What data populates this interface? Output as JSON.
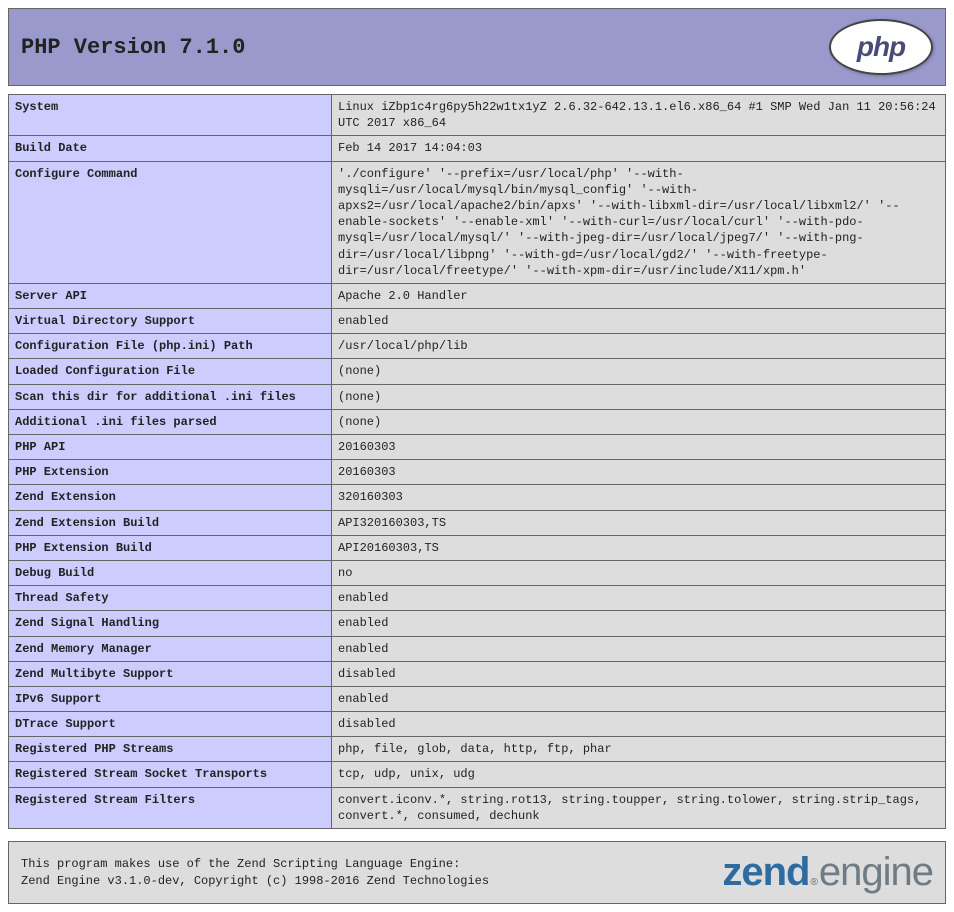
{
  "header": {
    "title": "PHP Version 7.1.0",
    "logo_text": "php"
  },
  "rows": [
    {
      "label": "System",
      "value": "Linux iZbp1c4rg6py5h22w1tx1yZ 2.6.32-642.13.1.el6.x86_64 #1 SMP Wed Jan 11 20:56:24 UTC 2017 x86_64"
    },
    {
      "label": "Build Date",
      "value": "Feb 14 2017 14:04:03"
    },
    {
      "label": "Configure Command",
      "value": "'./configure' '--prefix=/usr/local/php' '--with-mysqli=/usr/local/mysql/bin/mysql_config' '--with-apxs2=/usr/local/apache2/bin/apxs' '--with-libxml-dir=/usr/local/libxml2/' '--enable-sockets' '--enable-xml' '--with-curl=/usr/local/curl' '--with-pdo-mysql=/usr/local/mysql/' '--with-jpeg-dir=/usr/local/jpeg7/' '--with-png-dir=/usr/local/libpng' '--with-gd=/usr/local/gd2/' '--with-freetype-dir=/usr/local/freetype/' '--with-xpm-dir=/usr/include/X11/xpm.h'"
    },
    {
      "label": "Server API",
      "value": "Apache 2.0 Handler"
    },
    {
      "label": "Virtual Directory Support",
      "value": "enabled"
    },
    {
      "label": "Configuration File (php.ini) Path",
      "value": "/usr/local/php/lib"
    },
    {
      "label": "Loaded Configuration File",
      "value": "(none)"
    },
    {
      "label": "Scan this dir for additional .ini files",
      "value": "(none)"
    },
    {
      "label": "Additional .ini files parsed",
      "value": "(none)"
    },
    {
      "label": "PHP API",
      "value": "20160303"
    },
    {
      "label": "PHP Extension",
      "value": "20160303"
    },
    {
      "label": "Zend Extension",
      "value": "320160303"
    },
    {
      "label": "Zend Extension Build",
      "value": "API320160303,TS"
    },
    {
      "label": "PHP Extension Build",
      "value": "API20160303,TS"
    },
    {
      "label": "Debug Build",
      "value": "no"
    },
    {
      "label": "Thread Safety",
      "value": "enabled"
    },
    {
      "label": "Zend Signal Handling",
      "value": "enabled"
    },
    {
      "label": "Zend Memory Manager",
      "value": "enabled"
    },
    {
      "label": "Zend Multibyte Support",
      "value": "disabled"
    },
    {
      "label": "IPv6 Support",
      "value": "enabled"
    },
    {
      "label": "DTrace Support",
      "value": "disabled"
    },
    {
      "label": "Registered PHP Streams",
      "value": "php, file, glob, data, http, ftp, phar"
    },
    {
      "label": "Registered Stream Socket Transports",
      "value": "tcp, udp, unix, udg"
    },
    {
      "label": "Registered Stream Filters",
      "value": "convert.iconv.*, string.rot13, string.toupper, string.tolower, string.strip_tags, convert.*, consumed, dechunk"
    }
  ],
  "footer": {
    "line1": "This program makes use of the Zend Scripting Language Engine:",
    "line2": "Zend Engine v3.1.0-dev, Copyright (c) 1998-2016 Zend Technologies",
    "logo_zend": "zend",
    "logo_engine": "engine",
    "logo_reg": "®"
  }
}
